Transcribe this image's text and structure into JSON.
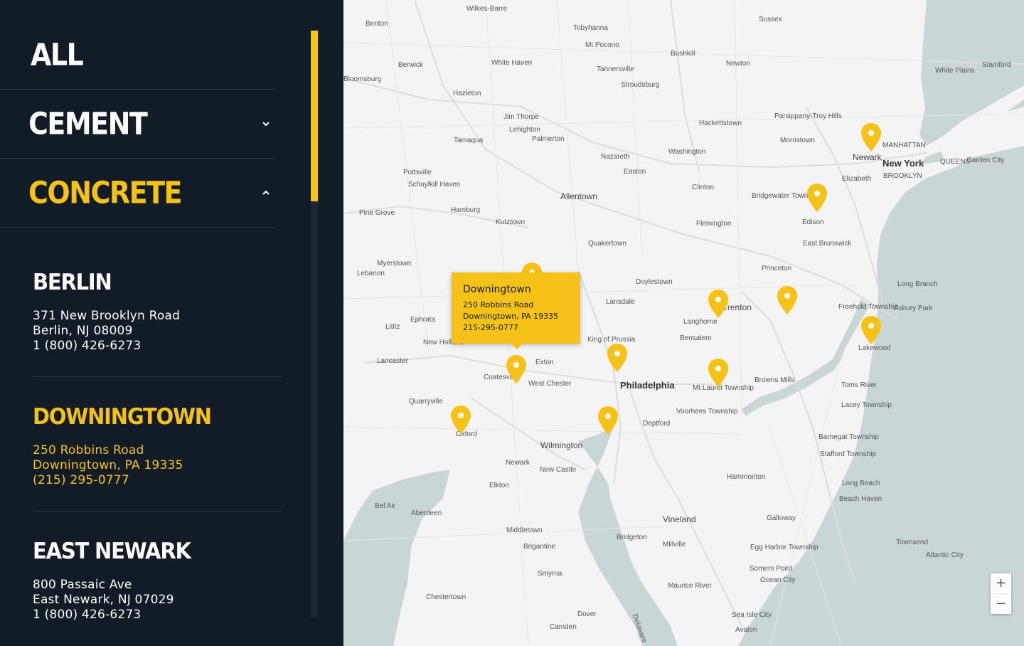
{
  "categories": [
    {
      "label": "ALL",
      "active": false,
      "chevron": "none"
    },
    {
      "label": "CEMENT",
      "active": false,
      "chevron": "down"
    },
    {
      "label": "CONCRETE",
      "active": true,
      "chevron": "up"
    }
  ],
  "locations": [
    {
      "name": "BERLIN",
      "line1": "371 New Brooklyn Road",
      "line2": "Berlin, NJ 08009",
      "line3": "1 (800) 426-6273",
      "active": false
    },
    {
      "name": "DOWNINGTOWN",
      "line1": "250 Robbins Road",
      "line2": "Downingtown, PA 19335",
      "line3": "(215) 295-0777",
      "active": true
    },
    {
      "name": "EAST NEWARK",
      "line1": "800 Passaic Ave",
      "line2": "East Newark, NJ 07029",
      "line3": "1 (800) 426-6273",
      "active": false
    }
  ],
  "popup": {
    "title": "Downingtown",
    "line1": "250 Robbins Road",
    "line2": "Downingtown, PA 19335",
    "line3": "215-295-0777"
  },
  "zoom": {
    "in": "+",
    "out": "−"
  },
  "colors": {
    "accent": "#f6c218",
    "sidebar": "#111c27",
    "water": "#c9d6d6",
    "land": "#f4f4f4"
  },
  "map_places": [
    {
      "t": "Wilkes-Barre",
      "s": ""
    },
    {
      "t": "Benton",
      "s": ""
    },
    {
      "t": "Tobyhanna",
      "s": ""
    },
    {
      "t": "Sussex",
      "s": ""
    },
    {
      "t": "Mt Pocono",
      "s": ""
    },
    {
      "t": "Berwick",
      "s": ""
    },
    {
      "t": "White Haven",
      "s": ""
    },
    {
      "t": "Tannersville",
      "s": ""
    },
    {
      "t": "Bushkill",
      "s": ""
    },
    {
      "t": "Newton",
      "s": ""
    },
    {
      "t": "White Plains",
      "s": ""
    },
    {
      "t": "Stamford",
      "s": ""
    },
    {
      "t": "Bloomsburg",
      "s": ""
    },
    {
      "t": "Stroudsburg",
      "s": ""
    },
    {
      "t": "Hazleton",
      "s": ""
    },
    {
      "t": "Jim Thorpe",
      "s": ""
    },
    {
      "t": "Lehighton",
      "s": ""
    },
    {
      "t": "Palmerton",
      "s": ""
    },
    {
      "t": "Hackettstown",
      "s": ""
    },
    {
      "t": "Parsippany-Troy Hills",
      "s": ""
    },
    {
      "t": "Tamaqua",
      "s": ""
    },
    {
      "t": "Morristown",
      "s": ""
    },
    {
      "t": "Newark",
      "s": "med"
    },
    {
      "t": "MANHATTAN",
      "s": ""
    },
    {
      "t": "Washington",
      "s": ""
    },
    {
      "t": "Nazareth",
      "s": ""
    },
    {
      "t": "New York",
      "s": "big"
    },
    {
      "t": "QUEENS",
      "s": ""
    },
    {
      "t": "Garden City",
      "s": ""
    },
    {
      "t": "Elizabeth",
      "s": ""
    },
    {
      "t": "BROOKLYN",
      "s": ""
    },
    {
      "t": "Easton",
      "s": ""
    },
    {
      "t": "Pottsville",
      "s": ""
    },
    {
      "t": "Schuylkill Haven",
      "s": ""
    },
    {
      "t": "Clinton",
      "s": ""
    },
    {
      "t": "Allentown",
      "s": "med"
    },
    {
      "t": "Bridgewater Township",
      "s": ""
    },
    {
      "t": "Pine Grove",
      "s": ""
    },
    {
      "t": "Hamburg",
      "s": ""
    },
    {
      "t": "Edison",
      "s": ""
    },
    {
      "t": "Flemington",
      "s": ""
    },
    {
      "t": "Kutztown",
      "s": ""
    },
    {
      "t": "East Brunswick",
      "s": ""
    },
    {
      "t": "Quakertown",
      "s": ""
    },
    {
      "t": "Myerstown",
      "s": ""
    },
    {
      "t": "Lebanon",
      "s": ""
    },
    {
      "t": "Princeton",
      "s": ""
    },
    {
      "t": "Doylestown",
      "s": ""
    },
    {
      "t": "Long Branch",
      "s": ""
    },
    {
      "t": "Lansdale",
      "s": ""
    },
    {
      "t": "Trenton",
      "s": "med"
    },
    {
      "t": "Freehold Township",
      "s": ""
    },
    {
      "t": "Asbury Park",
      "s": ""
    },
    {
      "t": "Ephrata",
      "s": ""
    },
    {
      "t": "Langhorne",
      "s": ""
    },
    {
      "t": "Lititz",
      "s": ""
    },
    {
      "t": "King of Prussia",
      "s": ""
    },
    {
      "t": "Bensalem",
      "s": ""
    },
    {
      "t": "New Holland",
      "s": ""
    },
    {
      "t": "Lakewood",
      "s": ""
    },
    {
      "t": "Lancaster",
      "s": ""
    },
    {
      "t": "Exton",
      "s": ""
    },
    {
      "t": "Coatesville",
      "s": ""
    },
    {
      "t": "West Chester",
      "s": ""
    },
    {
      "t": "Philadelphia",
      "s": "big"
    },
    {
      "t": "Browns Mills",
      "s": ""
    },
    {
      "t": "Mt Laurel Township",
      "s": ""
    },
    {
      "t": "Toms River",
      "s": ""
    },
    {
      "t": "Quarryville",
      "s": ""
    },
    {
      "t": "Voorhees Township",
      "s": ""
    },
    {
      "t": "Lacey Township",
      "s": ""
    },
    {
      "t": "Deptford",
      "s": ""
    },
    {
      "t": "Oxford",
      "s": ""
    },
    {
      "t": "Wilmington",
      "s": "med"
    },
    {
      "t": "Barnegat Township",
      "s": ""
    },
    {
      "t": "Stafford Township",
      "s": ""
    },
    {
      "t": "Newark",
      "s": ""
    },
    {
      "t": "New Castle",
      "s": ""
    },
    {
      "t": "Hammonton",
      "s": ""
    },
    {
      "t": "Elkton",
      "s": ""
    },
    {
      "t": "Long Beach",
      "s": ""
    },
    {
      "t": "Beach Haven",
      "s": ""
    },
    {
      "t": "Bel Air",
      "s": ""
    },
    {
      "t": "Aberdeen",
      "s": ""
    },
    {
      "t": "Galloway",
      "s": ""
    },
    {
      "t": "Vineland",
      "s": "med"
    },
    {
      "t": "Middletown",
      "s": ""
    },
    {
      "t": "Bridgeton",
      "s": ""
    },
    {
      "t": "Brigantine",
      "s": ""
    },
    {
      "t": "Townsend",
      "s": ""
    },
    {
      "t": "Millville",
      "s": ""
    },
    {
      "t": "Egg Harbor Township",
      "s": ""
    },
    {
      "t": "Atlantic City",
      "s": ""
    },
    {
      "t": "Somers Point",
      "s": ""
    },
    {
      "t": "Smyrna",
      "s": ""
    },
    {
      "t": "Ocean City",
      "s": ""
    },
    {
      "t": "Maurice River",
      "s": ""
    },
    {
      "t": "Chestertown",
      "s": ""
    },
    {
      "t": "Dover",
      "s": ""
    },
    {
      "t": "Sea Isle City",
      "s": ""
    },
    {
      "t": "Camden",
      "s": ""
    },
    {
      "t": "Avalon",
      "s": ""
    },
    {
      "t": "Delaware",
      "s": ""
    }
  ]
}
